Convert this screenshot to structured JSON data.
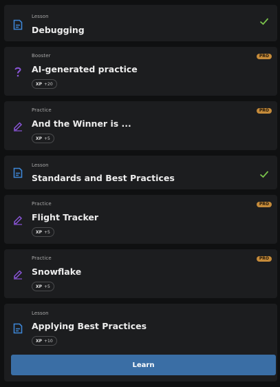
{
  "items": [
    {
      "type": "Lesson",
      "title": "Debugging",
      "completed": true,
      "pro": false,
      "xp": null,
      "icon": "lesson-icon"
    },
    {
      "type": "Booster",
      "title": "AI-generated practice",
      "completed": false,
      "pro": true,
      "xp": {
        "label": "XP",
        "value": "+20"
      },
      "icon": "question-icon"
    },
    {
      "type": "Practice",
      "title": "And the Winner is ...",
      "completed": false,
      "pro": true,
      "xp": {
        "label": "XP",
        "value": "+5"
      },
      "icon": "pencil-icon"
    },
    {
      "type": "Lesson",
      "title": "Standards and Best Practices",
      "completed": true,
      "pro": false,
      "xp": null,
      "icon": "lesson-icon"
    },
    {
      "type": "Practice",
      "title": "Flight Tracker",
      "completed": false,
      "pro": true,
      "xp": {
        "label": "XP",
        "value": "+5"
      },
      "icon": "pencil-icon"
    },
    {
      "type": "Practice",
      "title": "Snowflake",
      "completed": false,
      "pro": true,
      "xp": {
        "label": "XP",
        "value": "+5"
      },
      "icon": "pencil-icon"
    },
    {
      "type": "Lesson",
      "title": "Applying Best Practices",
      "completed": false,
      "pro": false,
      "xp": {
        "label": "XP",
        "value": "+10"
      },
      "icon": "lesson-icon"
    }
  ],
  "pro_label": "PRO",
  "learn_button": "Learn",
  "colors": {
    "card_bg": "#1c1d1f",
    "page_bg": "#0f1011",
    "lesson_icon": "#3d86d6",
    "practice_icon": "#8a55d8",
    "check": "#7bc44c",
    "pro_badge": "#c58b3a",
    "learn_button": "#3a6ea5"
  }
}
